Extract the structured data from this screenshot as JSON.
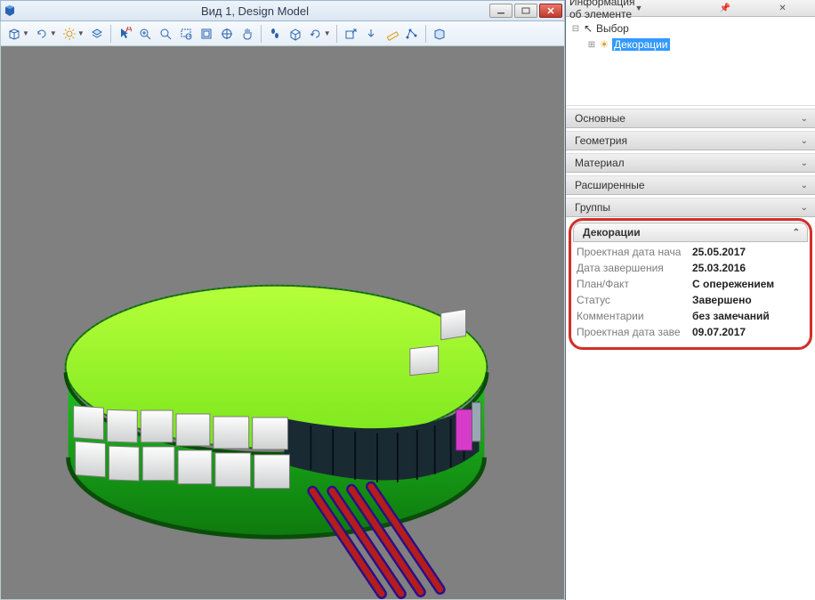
{
  "window": {
    "title": "Вид 1, Design Model"
  },
  "info_panel": {
    "title": "Информация об элементе"
  },
  "tree": {
    "root": "Выбор",
    "selected": "Декорации"
  },
  "sections": {
    "basic": "Основные",
    "geometry": "Геометрия",
    "material": "Материал",
    "extended": "Расширенные",
    "groups": "Группы",
    "decor": "Декорации"
  },
  "decor_props": [
    {
      "k": "Проектная дата нача",
      "v": "25.05.2017"
    },
    {
      "k": "Дата завершения",
      "v": "25.03.2016"
    },
    {
      "k": "План/Факт",
      "v": "С опережением"
    },
    {
      "k": "Статус",
      "v": "Завершено"
    },
    {
      "k": "Комментарии",
      "v": "без замечаний"
    },
    {
      "k": "Проектная дата заве",
      "v": "09.07.2017"
    }
  ],
  "toolbar_icons": [
    "cube",
    "refresh",
    "sun",
    "layers",
    "",
    "cursor-a",
    "zoom-in",
    "zoom-fit",
    "zoom-window",
    "frame",
    "target",
    "pan",
    "",
    "walk",
    "view-cube",
    "cycle",
    "",
    "export",
    "arrow-down",
    "ruler",
    "measure",
    "",
    "box-3d"
  ]
}
